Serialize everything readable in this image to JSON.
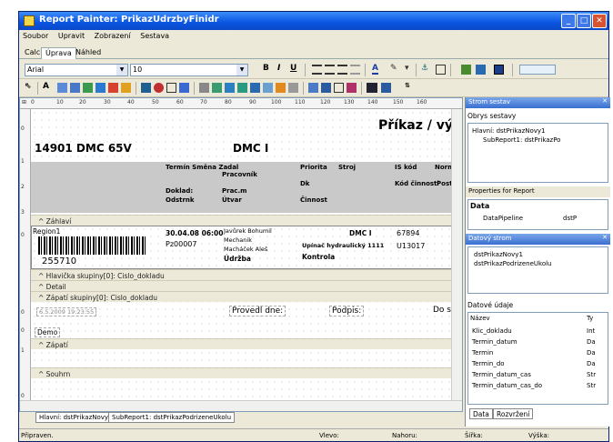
{
  "window": {
    "title": "Report Painter: PrikazUdrzbyFinidr"
  },
  "menu": [
    "Soubor",
    "Upravit",
    "Zobrazení",
    "Sestava"
  ],
  "mode_tabs": [
    "Calc",
    "Úprava",
    "Náhled"
  ],
  "font": {
    "name": "Arial",
    "size": "10"
  },
  "format_buttons": {
    "bold": "B",
    "italic": "I",
    "underline": "U"
  },
  "ruler_h": [
    "0",
    "10",
    "20",
    "30",
    "40",
    "50",
    "60",
    "70",
    "80",
    "90",
    "100",
    "110",
    "120",
    "130",
    "140",
    "150",
    "160"
  ],
  "ruler_v": [
    "0",
    "1",
    "2",
    "3",
    "0",
    "0",
    "0",
    "1",
    "0",
    "1"
  ],
  "report": {
    "title": "Příkaz / výkaz",
    "dmc_left": "14901 DMC 65V",
    "dmc_right": "DMC I",
    "headers": {
      "termin_smena_zadal": "Termín Směna Zadal",
      "pracovnik": "Pracovník",
      "priorita": "Priorita",
      "stroj": "Stroj",
      "is_kod": "IS kód",
      "norm": "Norm",
      "dk": "Dk",
      "kod_cinnosti": "Kód činnosti",
      "postu": "Postu",
      "dokladn": "Doklad:",
      "prac_m": "Prac.m",
      "utvar": "Útvar",
      "cinnost": "Činnost",
      "odstrn": "Odstrnk"
    },
    "bands": {
      "zahlavi": "^ Záhlaví",
      "hlavicka": "^ Hlavička skupiny[0]: Cislo_dokladu",
      "detail": "^ Detail",
      "zapati_skupiny": "^ Zápatí skupiny[0]: Cislo_dokladu",
      "zapati": "^ Zápatí",
      "souhrn": "^ Souhrn"
    },
    "region": "Region1",
    "barcode_number": "255710",
    "detail": {
      "datetime": "30.04.08 06:00",
      "pz": "Pz00007",
      "person1": "Javůrek Bohumil",
      "person2": "Mechanik",
      "person3": "Macháček Aleš",
      "udrzba": "Údržba",
      "dmc": "DMC I",
      "upinac": "Upínač hydraulický 1111",
      "kontrola": "Kontrola",
      "code1": "67894",
      "code2": "U13017"
    },
    "footer": {
      "date": "6.5.2009 19:23:55",
      "provedl": "Provedl dne:",
      "podpis": "Podpis:",
      "do": "Do s",
      "demo": "Demo"
    }
  },
  "report_tabs": [
    "Hlavní: dstPrikazNovy1",
    "SubReport1: dstPrikazPodrizeneUkolu"
  ],
  "panels": {
    "strom_sestav": {
      "title": "Strom sestav",
      "obrys_label": "Obrys sestavy",
      "items": [
        "Hlavní: dstPrikazNovy1",
        "SubReport1: dstPrikazPo"
      ]
    },
    "properties": {
      "title": "Properties for Report",
      "section": "Data",
      "rows": [
        {
          "name": "DataPipeline",
          "value": "dstP"
        }
      ]
    },
    "datovy_strom": {
      "title": "Datový strom",
      "items": [
        "dstPrikazNovy1",
        "dstPrikazPodrizeneUkolu"
      ],
      "fields_label": "Datové údaje",
      "columns": [
        "Název",
        "Ty"
      ],
      "fields": [
        {
          "name": "Klic_dokladu",
          "type": "Int"
        },
        {
          "name": "Termin_datum",
          "type": "Da"
        },
        {
          "name": "Termin",
          "type": "Da"
        },
        {
          "name": "Termin_do",
          "type": "Da"
        },
        {
          "name": "Termin_datum_cas",
          "type": "Str"
        },
        {
          "name": "Termin_datum_cas_do",
          "type": "Str"
        }
      ],
      "tabs": [
        "Data",
        "Rozvržení"
      ]
    }
  },
  "status": {
    "ready": "Připraven.",
    "left": "Vlevo:",
    "top": "Nahoru:",
    "width": "Šířka:",
    "height": "Výška:"
  }
}
